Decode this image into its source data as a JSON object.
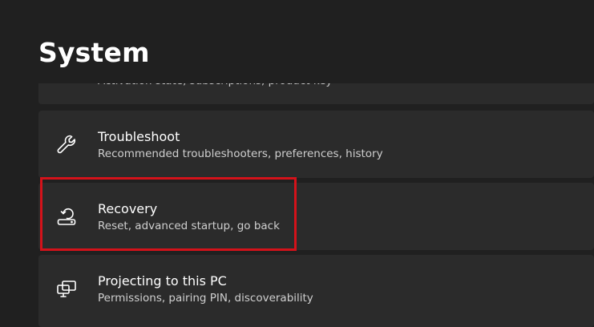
{
  "header": {
    "title": "System"
  },
  "items": [
    {
      "title": "",
      "subtitle": "Activation state, subscriptions, product key",
      "icon": "activation-icon"
    },
    {
      "title": "Troubleshoot",
      "subtitle": "Recommended troubleshooters, preferences, history",
      "icon": "wrench-icon"
    },
    {
      "title": "Recovery",
      "subtitle": "Reset, advanced startup, go back",
      "icon": "recovery-icon"
    },
    {
      "title": "Projecting to this PC",
      "subtitle": "Permissions, pairing PIN, discoverability",
      "icon": "projecting-icon"
    }
  ],
  "highlight": {
    "color": "#d4121a",
    "target": "Recovery"
  },
  "colors": {
    "background": "#202020",
    "card": "#2b2b2b",
    "text_primary": "#ffffff",
    "text_secondary": "#cfcfcf"
  }
}
